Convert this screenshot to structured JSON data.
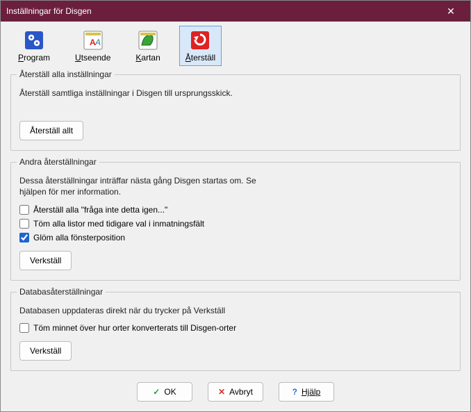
{
  "window": {
    "title": "Inställningar för Disgen"
  },
  "tabs": {
    "program": {
      "label": "Program",
      "underline": "P"
    },
    "utseende": {
      "label": "Utseende",
      "underline": "U"
    },
    "kartan": {
      "label": "Kartan",
      "underline": "K"
    },
    "aterstall": {
      "label": "Återställ",
      "underline": "Å"
    }
  },
  "group1": {
    "legend": "Återställ alla inställningar",
    "desc": "Återställ samtliga inställningar i Disgen till ursprungsskick.",
    "button": "Återställ allt"
  },
  "group2": {
    "legend": "Andra återställningar",
    "desc": "Dessa återställningar inträffar nästa gång Disgen startas om.  Se hjälpen för mer information.",
    "chk1": "Återställ alla \"fråga inte detta igen...\"",
    "chk2": "Töm alla listor med tidigare val i inmatningsfält",
    "chk3": "Glöm alla fönsterposition",
    "button": "Verkställ"
  },
  "group3": {
    "legend": "Databasåterställningar",
    "desc": "Databasen uppdateras direkt när du trycker på Verkställ",
    "chk1": "Töm minnet över hur orter konverterats till Disgen-orter",
    "button": "Verkställ"
  },
  "footer": {
    "ok": "OK",
    "cancel": "Avbryt",
    "help": "Hjälp"
  }
}
